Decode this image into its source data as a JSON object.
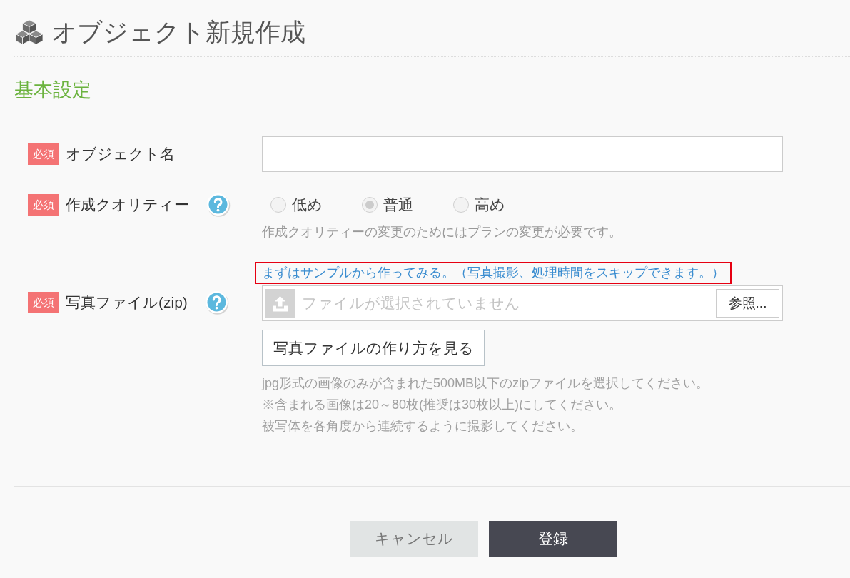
{
  "header": {
    "title": "オブジェクト新規作成"
  },
  "section": {
    "title": "基本設定"
  },
  "fields": [
    {
      "kind": "text",
      "badge": "必須",
      "label": "オブジェクト名",
      "help": false
    },
    {
      "kind": "radio",
      "badge": "必須",
      "label": "作成クオリティー",
      "help": true,
      "disabled": true,
      "options": [
        {
          "label": "低め",
          "selected": false
        },
        {
          "label": "普通",
          "selected": true
        },
        {
          "label": "高め",
          "selected": false
        }
      ],
      "note": "作成クオリティーの変更のためにはプランの変更が必要です。"
    },
    {
      "kind": "file",
      "badge": "必須",
      "label": "写真ファイル(zip)",
      "help": true,
      "sample_link": "まずはサンプルから作ってみる。（写真撮影、処理時間をスキップできます。）",
      "placeholder": "ファイルが選択されていません",
      "browse_button": "参照...",
      "guide_button": "写真ファイルの作り方を見る",
      "notes": [
        "jpg形式の画像のみが含まれた500MB以下のzipファイルを選択してください。",
        "※含まれる画像は20～80枚(推奨は30枚以上)にしてください。",
        "被写体を各角度から連続するように撮影してください。"
      ]
    }
  ],
  "buttons": [
    {
      "label": "キャンセル",
      "kind": "secondary"
    },
    {
      "label": "登録",
      "kind": "primary"
    }
  ]
}
